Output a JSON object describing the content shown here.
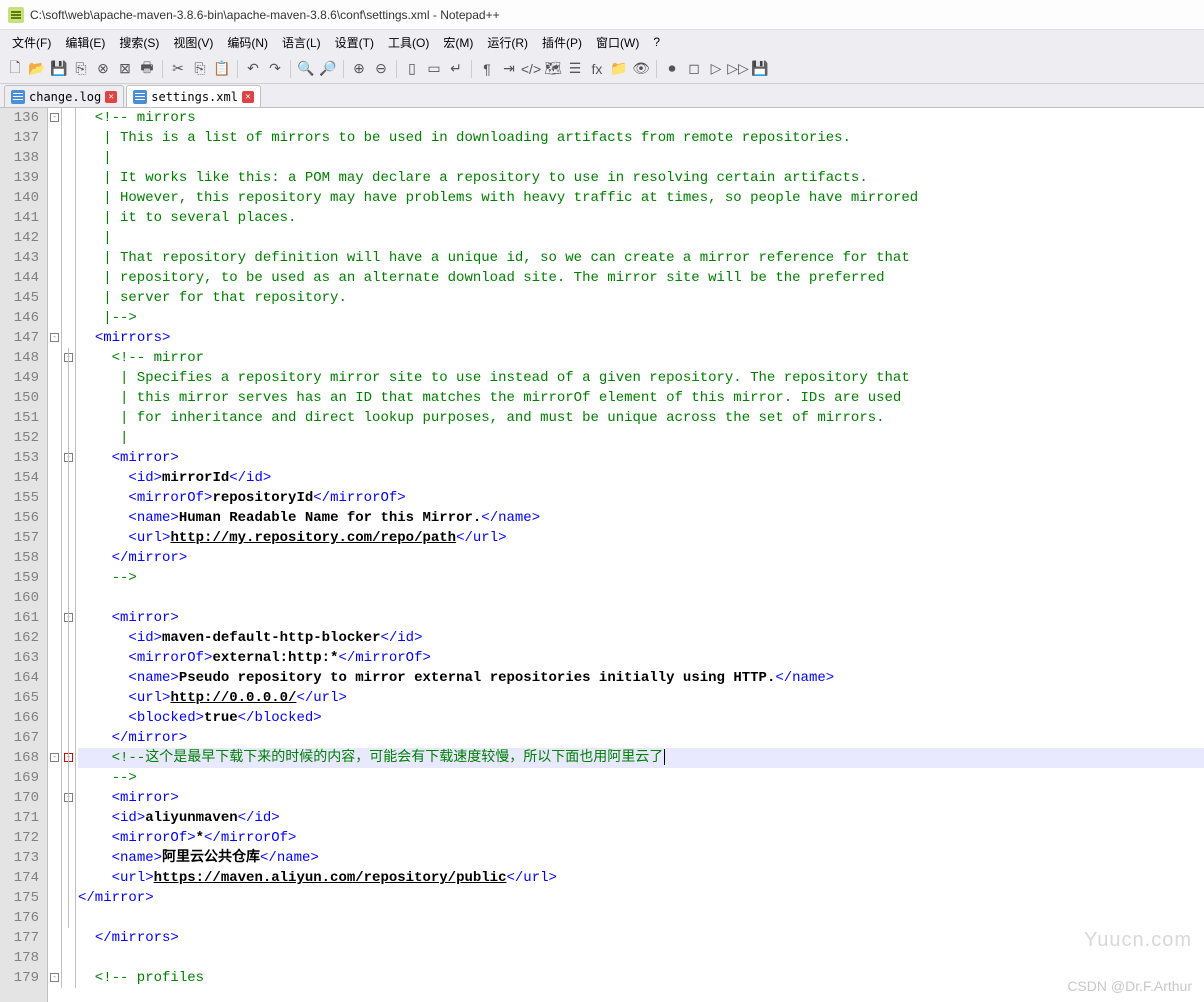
{
  "title": "C:\\soft\\web\\apache-maven-3.8.6-bin\\apache-maven-3.8.6\\conf\\settings.xml - Notepad++",
  "menu": [
    "文件(F)",
    "编辑(E)",
    "搜索(S)",
    "视图(V)",
    "编码(N)",
    "语言(L)",
    "设置(T)",
    "工具(O)",
    "宏(M)",
    "运行(R)",
    "插件(P)",
    "窗口(W)",
    "?"
  ],
  "tabs": [
    {
      "label": "change.log",
      "active": false
    },
    {
      "label": "settings.xml",
      "active": true
    }
  ],
  "lines": {
    "start": 136,
    "end": 179,
    "highlight": 168
  },
  "code": {
    "l136": "  <!-- mirrors",
    "l137": "   | This is a list of mirrors to be used in downloading artifacts from remote repositories.",
    "l138": "   |",
    "l139": "   | It works like this: a POM may declare a repository to use in resolving certain artifacts.",
    "l140": "   | However, this repository may have problems with heavy traffic at times, so people have mirrored",
    "l141": "   | it to several places.",
    "l142": "   |",
    "l143": "   | That repository definition will have a unique id, so we can create a mirror reference for that",
    "l144": "   | repository, to be used as an alternate download site. The mirror site will be the preferred",
    "l145": "   | server for that repository.",
    "l146": "   |-->",
    "l148": "    <!-- mirror",
    "l149": "     | Specifies a repository mirror site to use instead of a given repository. The repository that",
    "l150": "     | this mirror serves has an ID that matches the mirrorOf element of this mirror. IDs are used",
    "l151": "     | for inheritance and direct lookup purposes, and must be unique across the set of mirrors.",
    "l152": "     |",
    "l159": "    -->",
    "l168": "    <!--这个是最早下载下来的时候的内容，可能会有下载速度较慢，所以下面也用阿里云了",
    "l169": "    -->",
    "l179": "  <!-- profiles"
  },
  "xml": {
    "mirrors_open": "<mirrors>",
    "mirrors_close": "</mirrors>",
    "mirror_open": "<mirror>",
    "mirror_close": "</mirror>",
    "id_o": "<id>",
    "id_c": "</id>",
    "mOf_o": "<mirrorOf>",
    "mOf_c": "</mirrorOf>",
    "name_o": "<name>",
    "name_c": "</name>",
    "url_o": "<url>",
    "url_c": "</url>",
    "blocked_o": "<blocked>",
    "blocked_c": "</blocked>",
    "v_mirrorId": "mirrorId",
    "v_repoId": "repositoryId",
    "v_humanname": "Human Readable Name for this Mirror.",
    "v_repourl": "http://my.repository.com/repo/path",
    "v_blockerid": "maven-default-http-blocker",
    "v_external": "external:http:*",
    "v_pseudo": "Pseudo repository to mirror external repositories initially using HTTP.",
    "v_0000": "http://0.0.0.0/",
    "v_true": "true",
    "v_aliyun": "aliyunmaven",
    "v_star": "*",
    "v_aliname": "阿里云公共仓库",
    "v_aliurl": "https://maven.aliyun.com/repository/public"
  },
  "watermark1": "Yuucn.com",
  "watermark2": "CSDN @Dr.F.Arthur"
}
